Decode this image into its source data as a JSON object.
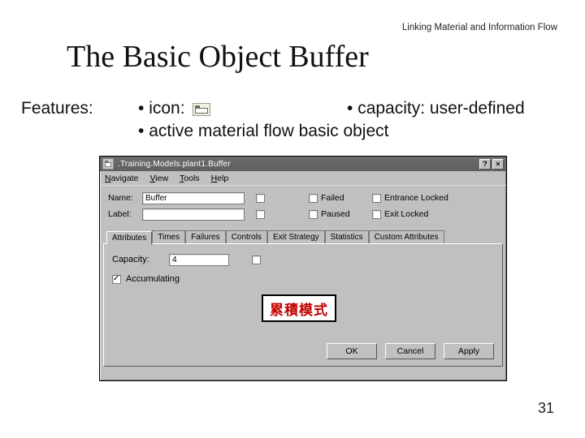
{
  "slide": {
    "section": "Linking Material and Information Flow",
    "title": "The Basic Object Buffer",
    "features_label": "Features:",
    "bullet_icon": "icon:",
    "bullet_capacity": "capacity: user-defined",
    "bullet_active": "active material flow basic object",
    "page_number": "31"
  },
  "dialog": {
    "title": ".Training.Models.plant1.Buffer",
    "menubar": [
      "Navigate",
      "View",
      "Tools",
      "Help"
    ],
    "name_label": "Name:",
    "name_value": "Buffer",
    "label_label": "Label:",
    "label_value": "",
    "right_checks_row1": [
      "Failed",
      "Entrance Locked"
    ],
    "right_checks_row2": [
      "Paused",
      "Exit Locked"
    ],
    "tabs": [
      "Attributes",
      "Times",
      "Failures",
      "Controls",
      "Exit Strategy",
      "Statistics",
      "Custom Attributes"
    ],
    "active_tab": 0,
    "capacity_label": "Capacity:",
    "capacity_value": "4",
    "accumulating_label": "Accumulating",
    "accumulating_checked": true,
    "annotation": "累積模式",
    "buttons": [
      "OK",
      "Cancel",
      "Apply"
    ],
    "titlebar_help": "?",
    "titlebar_close": "×"
  }
}
